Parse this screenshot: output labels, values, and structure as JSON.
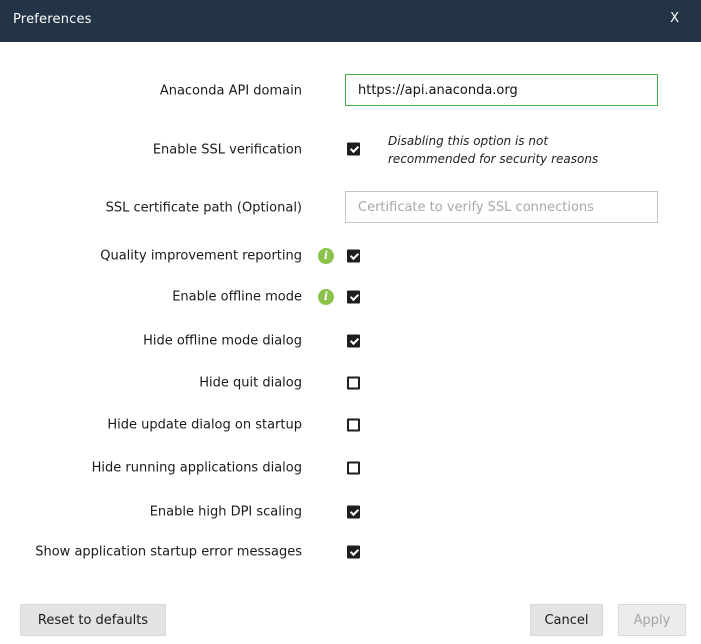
{
  "dialog": {
    "title": "Preferences",
    "close_label": "X"
  },
  "fields": {
    "api_domain": {
      "label": "Anaconda API domain",
      "value": "https://api.anaconda.org",
      "placeholder": ""
    },
    "ssl_verification": {
      "label": "Enable SSL verification",
      "checked": true,
      "note": "Disabling this option is not recommended for security reasons"
    },
    "ssl_cert_path": {
      "label": "SSL certificate path (Optional)",
      "value": "",
      "placeholder": "Certificate to verify SSL connections"
    }
  },
  "options": [
    {
      "label": "Quality improvement reporting",
      "checked": true,
      "info": true
    },
    {
      "label": "Enable offline mode",
      "checked": true,
      "info": true
    },
    {
      "label": "Hide offline mode dialog",
      "checked": true,
      "info": false
    },
    {
      "label": "Hide quit dialog",
      "checked": false,
      "info": false
    },
    {
      "label": "Hide update dialog on startup",
      "checked": false,
      "info": false
    },
    {
      "label": "Hide running applications dialog",
      "checked": false,
      "info": false
    },
    {
      "label": "Enable high DPI scaling",
      "checked": true,
      "info": false
    },
    {
      "label": "Show application startup error messages",
      "checked": true,
      "info": false
    }
  ],
  "info_glyph": "i",
  "icons": {
    "info": "info-icon",
    "close": "close-icon"
  },
  "colors": {
    "titlebar": "#243447",
    "active_border": "#43b049",
    "info_badge": "#8bc34a"
  },
  "buttons": {
    "reset": "Reset to defaults",
    "cancel": "Cancel",
    "apply": "Apply",
    "apply_enabled": false
  }
}
